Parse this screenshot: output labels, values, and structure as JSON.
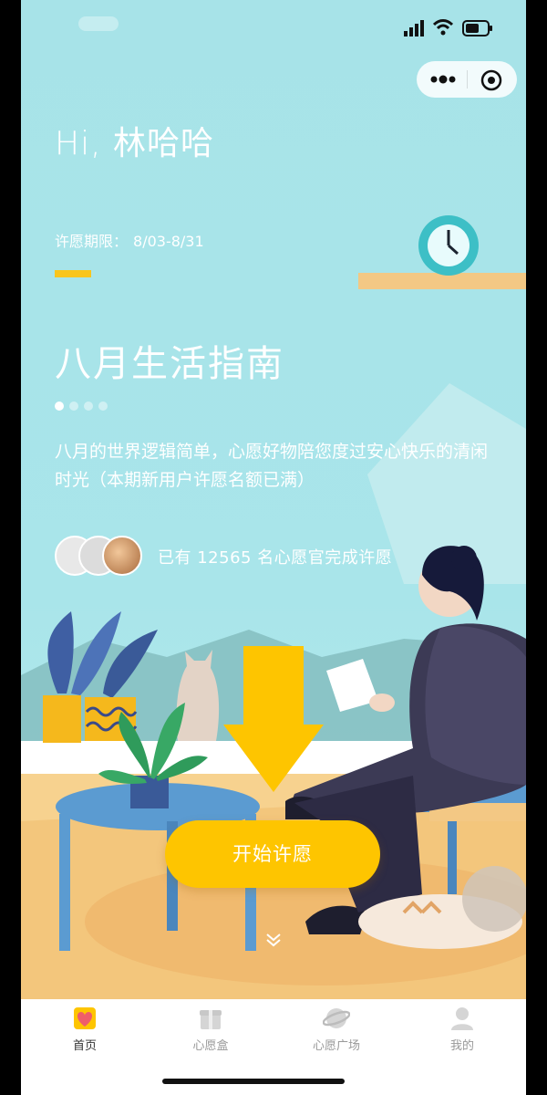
{
  "greeting": "Hi, 林哈哈",
  "period": {
    "label": "许愿期限：",
    "value": "8/03-8/31"
  },
  "headline": "八月生活指南",
  "carousel": {
    "total_dots": 4,
    "active_index": 0
  },
  "description": "八月的世界逻辑简单，心愿好物陪您度过安心快乐的清闲时光（本期新用户许愿名额已满）",
  "participants": {
    "text": "已有 12565 名心愿官完成许愿"
  },
  "cta": {
    "label": "开始许愿"
  },
  "tabbar": {
    "items": [
      {
        "label": "首页",
        "icon": "home-heart-icon",
        "active": true
      },
      {
        "label": "心愿盒",
        "icon": "gift-box-icon",
        "active": false
      },
      {
        "label": "心愿广场",
        "icon": "planet-icon",
        "active": false
      },
      {
        "label": "我的",
        "icon": "profile-icon",
        "active": false
      }
    ]
  },
  "colors": {
    "background": "#a7e3e8",
    "accent": "#fec500",
    "text": "#ffffff",
    "tab_inactive": "#999999"
  }
}
